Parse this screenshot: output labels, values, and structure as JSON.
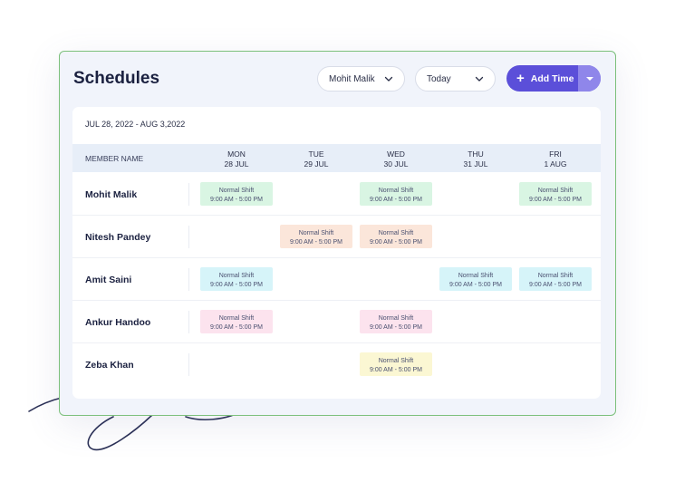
{
  "header": {
    "title": "Schedules",
    "member_select": "Mohit Malik",
    "range_select": "Today",
    "add_button": "Add Time"
  },
  "date_range": "JUL 28, 2022 - AUG 3,2022",
  "table": {
    "member_col": "MEMBER NAME",
    "days": [
      {
        "dow": "MON",
        "date": "28 JUL"
      },
      {
        "dow": "TUE",
        "date": "29 JUL"
      },
      {
        "dow": "WED",
        "date": "30 JUL"
      },
      {
        "dow": "THU",
        "date": "31 JUL"
      },
      {
        "dow": "FRI",
        "date": "1 AUG"
      }
    ],
    "members": [
      {
        "name": "Mohit Malik",
        "shifts": [
          {
            "day": 0,
            "label": "Normal Shift",
            "time": "9:00 AM - 5:00 PM",
            "color": "#d9f5e3"
          },
          {
            "day": 2,
            "label": "Normal Shift",
            "time": "9:00 AM - 5:00 PM",
            "color": "#d9f5e3"
          },
          {
            "day": 4,
            "label": "Normal Shift",
            "time": "9:00 AM - 5:00 PM",
            "color": "#d9f5e3"
          }
        ]
      },
      {
        "name": "Nitesh Pandey",
        "shifts": [
          {
            "day": 1,
            "label": "Normal Shift",
            "time": "9:00 AM - 5:00 PM",
            "color": "#fbe6da"
          },
          {
            "day": 2,
            "label": "Normal Shift",
            "time": "9:00 AM - 5:00 PM",
            "color": "#fbe6da"
          }
        ]
      },
      {
        "name": "Amit Saini",
        "shifts": [
          {
            "day": 0,
            "label": "Normal Shift",
            "time": "9:00 AM - 5:00 PM",
            "color": "#d6f4f9"
          },
          {
            "day": 3,
            "label": "Normal Shift",
            "time": "9:00 AM - 5:00 PM",
            "color": "#d6f4f9"
          },
          {
            "day": 4,
            "label": "Normal Shift",
            "time": "9:00 AM - 5:00 PM",
            "color": "#d6f4f9"
          }
        ]
      },
      {
        "name": "Ankur Handoo",
        "shifts": [
          {
            "day": 0,
            "label": "Normal Shift",
            "time": "9:00 AM - 5:00 PM",
            "color": "#fce3ee"
          },
          {
            "day": 2,
            "label": "Normal Shift",
            "time": "9:00 AM - 5:00 PM",
            "color": "#fce3ee"
          }
        ]
      },
      {
        "name": "Zeba Khan",
        "shifts": [
          {
            "day": 2,
            "label": "Normal Shift",
            "time": "9:00 AM - 5:00 PM",
            "color": "#fbf7d3"
          }
        ]
      }
    ]
  },
  "colors": {
    "accent": "#5b4fd9",
    "accent_light": "#8f86ea",
    "frame_border": "#7cc07c"
  },
  "icons": {
    "dropdown": "chevron-down-icon",
    "add": "plus-icon",
    "split": "caret-down-icon"
  }
}
